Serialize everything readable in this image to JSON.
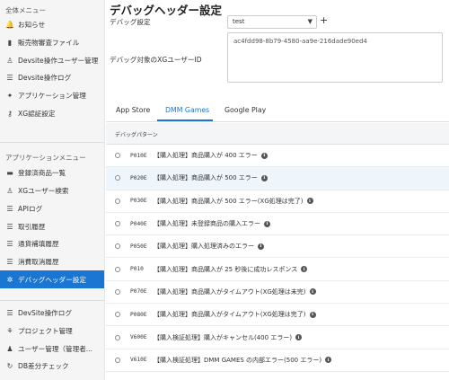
{
  "sidebar": {
    "section1_title": "全体メニュー",
    "items1": [
      {
        "label": "お知らせ",
        "icon": "bell-icon"
      },
      {
        "label": "販売物審査ファイル",
        "icon": "file-icon"
      },
      {
        "label": "Devsite操作ユーザー管理",
        "icon": "user-icon"
      },
      {
        "label": "Devsite操作ログ",
        "icon": "list-icon"
      },
      {
        "label": "アプリケーション管理",
        "icon": "lightbulb-icon"
      },
      {
        "label": "XG認証設定",
        "icon": "key-icon"
      }
    ],
    "section2_title": "アプリケーションメニュー",
    "items2": [
      {
        "label": "登録済商品一覧",
        "icon": "box-icon"
      },
      {
        "label": "XGユーザー検索",
        "icon": "person-icon"
      },
      {
        "label": "APIログ",
        "icon": "list-icon"
      },
      {
        "label": "取引履歴",
        "icon": "list-icon"
      },
      {
        "label": "通貨補填履歴",
        "icon": "list-icon"
      },
      {
        "label": "消費取消履歴",
        "icon": "list-icon"
      },
      {
        "label": "デバッグヘッダー設定",
        "icon": "bug-icon",
        "active": true
      }
    ],
    "items3": [
      {
        "label": "DevSite操作ログ",
        "icon": "list-icon"
      },
      {
        "label": "プロジェクト管理",
        "icon": "tree-icon"
      },
      {
        "label": "ユーザー管理（管理者...",
        "icon": "users-icon"
      },
      {
        "label": "DB差分チェック",
        "icon": "sync-icon"
      }
    ]
  },
  "main": {
    "title": "デバッグヘッダー設定",
    "setting_label": "デバッグ設定",
    "select_value": "test",
    "add_label": "+",
    "target_label": "デバッグ対象のXGユーザーID",
    "target_value": "ac4fdd98-8b79-4580-aa9e-216dade90ed4",
    "tabs": [
      "App Store",
      "DMM Games",
      "Google Play"
    ],
    "active_tab": "DMM Games",
    "table_header": "デバッグパターン",
    "rows": [
      {
        "code": "P010E",
        "desc": "【購入処理】商品購入が 400 エラー",
        "highlight": false
      },
      {
        "code": "P020E",
        "desc": "【購入処理】商品購入が 500 エラー",
        "highlight": true
      },
      {
        "code": "P030E",
        "desc": "【購入処理】商品購入が 500 エラー(XG処理は完了)",
        "highlight": false
      },
      {
        "code": "P040E",
        "desc": "【購入処理】未登録商品の購入エラー",
        "highlight": false
      },
      {
        "code": "P050E",
        "desc": "【購入処理】購入処理済みのエラー",
        "highlight": false
      },
      {
        "code": "P010",
        "desc": "【購入処理】商品購入が 25 秒後に成功レスポンス",
        "highlight": false
      },
      {
        "code": "P070E",
        "desc": "【購入処理】商品購入がタイムアウト(XG処理は未完)",
        "highlight": false
      },
      {
        "code": "P080E",
        "desc": "【購入処理】商品購入がタイムアウト(XG処理は完了)",
        "highlight": false
      },
      {
        "code": "V600E",
        "desc": "【購入検証処理】購入がキャンセル(400 エラー)",
        "highlight": false
      },
      {
        "code": "V610E",
        "desc": "【購入検証処理】DMM GAMES の内部エラー(500 エラー)",
        "highlight": false
      }
    ]
  },
  "colors": {
    "accent": "#1976d2",
    "highlight_row": "#eef6fc"
  }
}
